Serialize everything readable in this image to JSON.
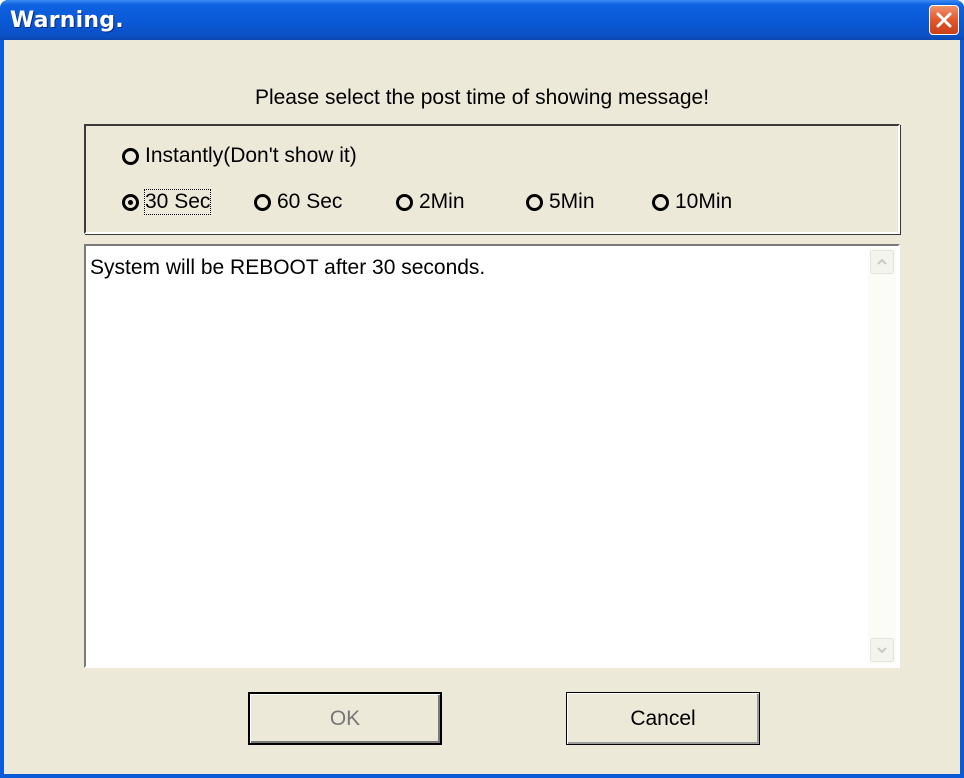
{
  "window": {
    "title": "Warning."
  },
  "prompt": "Please select the post time of showing message!",
  "options": {
    "instantly": "Instantly(Don't show it)",
    "sec30": "30 Sec",
    "sec60": "60 Sec",
    "min2": "2Min",
    "min5": "5Min",
    "min10": "10Min",
    "selected": "30 Sec"
  },
  "message": "System will be REBOOT after 30 seconds.",
  "buttons": {
    "ok": "OK",
    "cancel": "Cancel"
  },
  "icons": {
    "close": "close-icon",
    "scroll_up": "chevron-up-icon",
    "scroll_down": "chevron-down-icon"
  },
  "colors": {
    "titlebar": "#0a58d6",
    "close_button": "#e2572a",
    "dialog_face": "#ece9d8"
  }
}
